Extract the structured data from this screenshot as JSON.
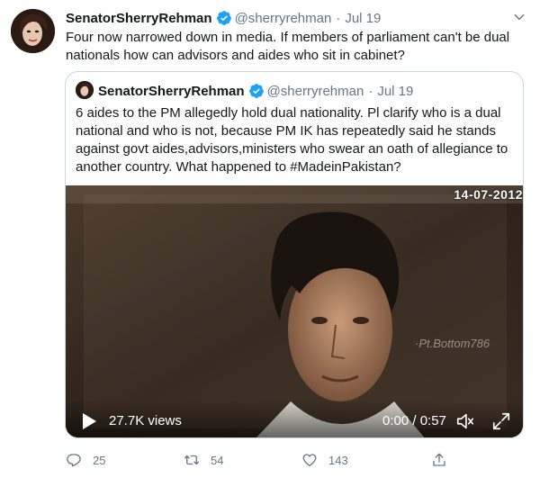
{
  "tweet": {
    "display_name": "SenatorSherryRehman",
    "handle": "@sherryrehman",
    "separator": "·",
    "date": "Jul 19",
    "text": "Four now narrowed down in media. If members of parliament can't be dual nationals how can advisors and aides who sit in cabinet?"
  },
  "quoted_tweet": {
    "display_name": "SenatorSherryRehman",
    "handle": "@sherryrehman",
    "separator": "·",
    "date": "Jul 19",
    "text": "6 aides to the PM allegedly hold dual nationality. Pl clarify who is a dual national and who is not, because PM IK has repeatedly said he stands against govt aides,advisors,ministers who swear an oath of allegiance to another country. What happened to #MadeinPakistan?"
  },
  "video": {
    "date_stamp": "14-07-2012",
    "watermark": "·Pt.Bottom786",
    "views": "27.7K views",
    "time": "0:00 / 0:57"
  },
  "actions": {
    "reply_count": "25",
    "retweet_count": "54",
    "like_count": "143"
  },
  "colors": {
    "text": "#14171a",
    "muted": "#657786",
    "verified": "#1da1f2",
    "border": "#ccd6dd"
  },
  "icons": [
    "verified-badge-icon",
    "chevron-down-icon",
    "play-icon",
    "volume-icon",
    "fullscreen-icon",
    "reply-icon",
    "retweet-icon",
    "like-icon",
    "share-icon"
  ]
}
